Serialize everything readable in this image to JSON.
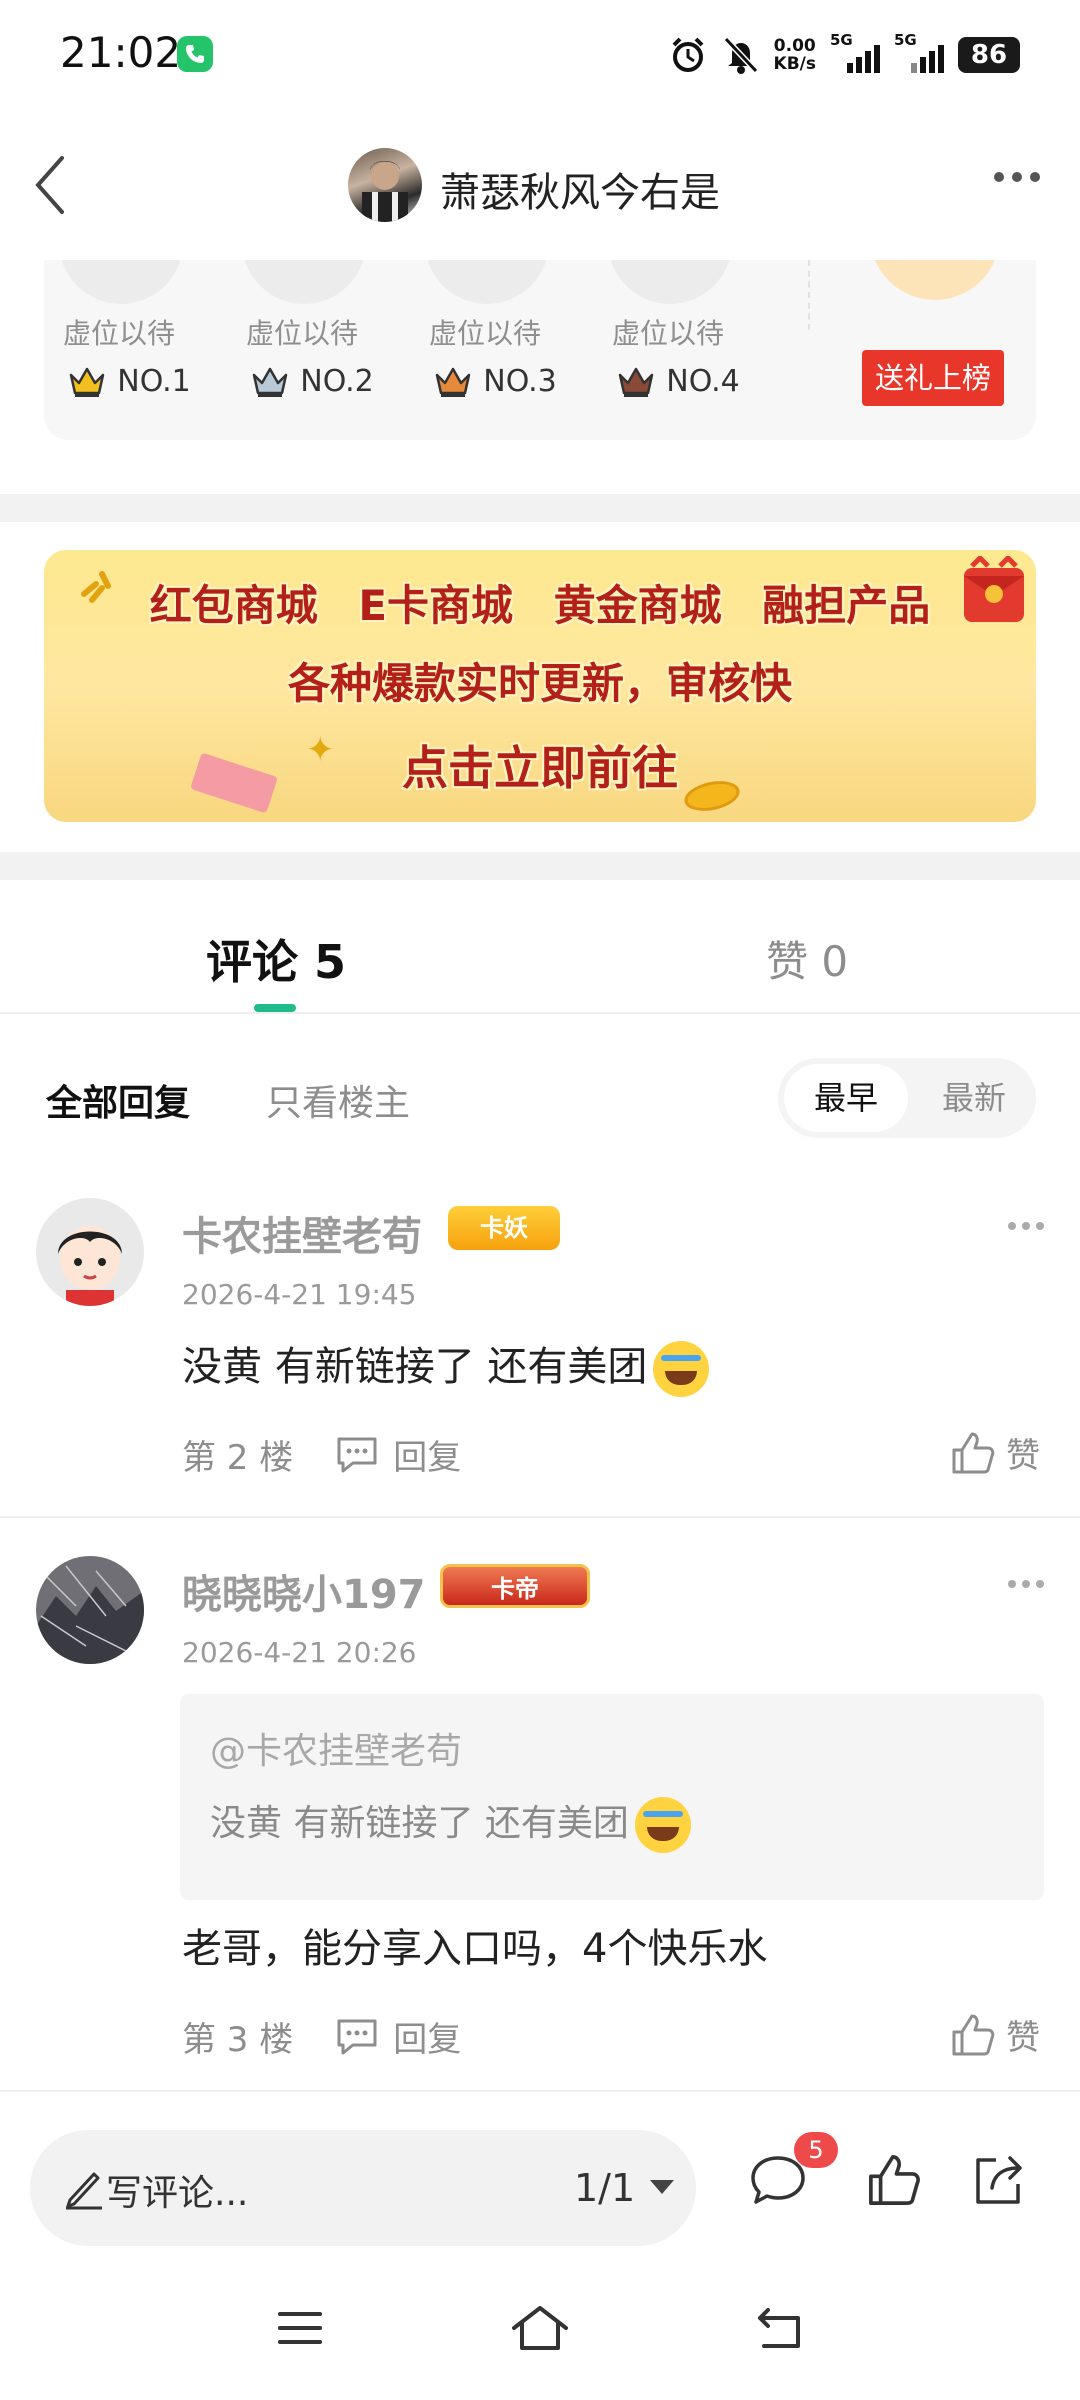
{
  "status_bar": {
    "time": "21:02",
    "net_speed_value": "0.00",
    "net_speed_unit": "KB/s",
    "signal1_label": "5G",
    "signal2_label": "5G",
    "battery": "86"
  },
  "header": {
    "title": "萧瑟秋风今右是"
  },
  "gift_rank": {
    "slots": [
      {
        "label": "虚位以待",
        "rank": "NO.1",
        "crown_color": "#f2c01e"
      },
      {
        "label": "虚位以待",
        "rank": "NO.2",
        "crown_color": "#b9c9d8"
      },
      {
        "label": "虚位以待",
        "rank": "NO.3",
        "crown_color": "#e58a3a"
      },
      {
        "label": "虚位以待",
        "rank": "NO.4",
        "crown_color": "#8a4a35"
      }
    ],
    "gift_button": "送礼上榜"
  },
  "banner": {
    "line1": "红包商城 E卡商城 黄金商城 融担产品",
    "line2": "各种爆款实时更新，审核快",
    "line3": "点击立即前往"
  },
  "tabs": {
    "comments": "评论 5",
    "likes": "赞 0"
  },
  "filters": {
    "all": "全部回复",
    "owner_only": "只看楼主",
    "earliest": "最早",
    "latest": "最新"
  },
  "comments": [
    {
      "author": "卡农挂壁老苟",
      "badge": "卡妖",
      "time": "2026-4-21 19:45",
      "text": "没黄 有新链接了 还有美团",
      "floor": "第 2 楼",
      "reply": "回复",
      "like": "赞"
    },
    {
      "author": "晓晓晓小197",
      "badge": "卡帝",
      "time": "2026-4-21 20:26",
      "quote_at": "@卡农挂壁老苟",
      "quote_text": "没黄 有新链接了 还有美团",
      "text": "老哥，能分享入口吗，4个快乐水",
      "floor": "第 3 楼",
      "reply": "回复",
      "like": "赞"
    }
  ],
  "bottom_bar": {
    "write_placeholder": "写评论...",
    "page_indicator": "1/1",
    "comment_count_badge": "5"
  },
  "colors": {
    "accent": "#1fbb8a",
    "gift_button": "#e8372a",
    "badge_red": "#ef4a4a"
  }
}
